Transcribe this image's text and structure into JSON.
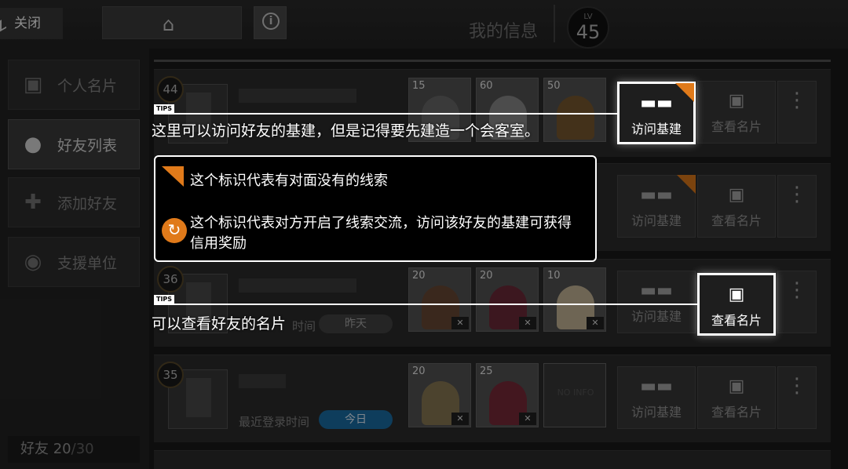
{
  "topbar": {
    "close_label": "关闭",
    "my_info_label": "我的信息",
    "lv_label": "LV",
    "lv_value": "45"
  },
  "sidebar": {
    "items": [
      {
        "label": "个人名片"
      },
      {
        "label": "好友列表"
      },
      {
        "label": "添加好友"
      },
      {
        "label": "支援单位"
      }
    ],
    "friend_count_label": "好友",
    "friend_count": "20",
    "friend_max": "/30"
  },
  "rows": [
    {
      "level": "44",
      "ops": [
        {
          "lv": "15"
        },
        {
          "lv": "60"
        },
        {
          "lv": "50"
        }
      ]
    },
    {
      "level": "",
      "ops": []
    },
    {
      "level": "36",
      "login_label": "时间",
      "login_value": "昨天",
      "ops": [
        {
          "lv": "20"
        },
        {
          "lv": "20"
        },
        {
          "lv": "10"
        }
      ]
    },
    {
      "level": "35",
      "login_label": "最近登录时间",
      "login_value": "今日",
      "ops": [
        {
          "lv": "20"
        },
        {
          "lv": "25"
        }
      ],
      "no_info": "NO INFO"
    }
  ],
  "buttons": {
    "visit_base": "访问基建",
    "view_card": "查看名片"
  },
  "tips": {
    "tag": "TIPS",
    "visit_tip": "这里可以访问好友的基建，但是记得要先建造一个会客室。",
    "card_tip": "可以查看好友的名片"
  },
  "legend": {
    "clue_flag_text": "这个标识代表有对面没有的线索",
    "exchange_text": "这个标识代表对方开启了线索交流，访问该好友的基建可获得信用奖励"
  },
  "colors": {
    "accent_orange": "#e07a1a",
    "today_blue": "#1b6fa8"
  }
}
